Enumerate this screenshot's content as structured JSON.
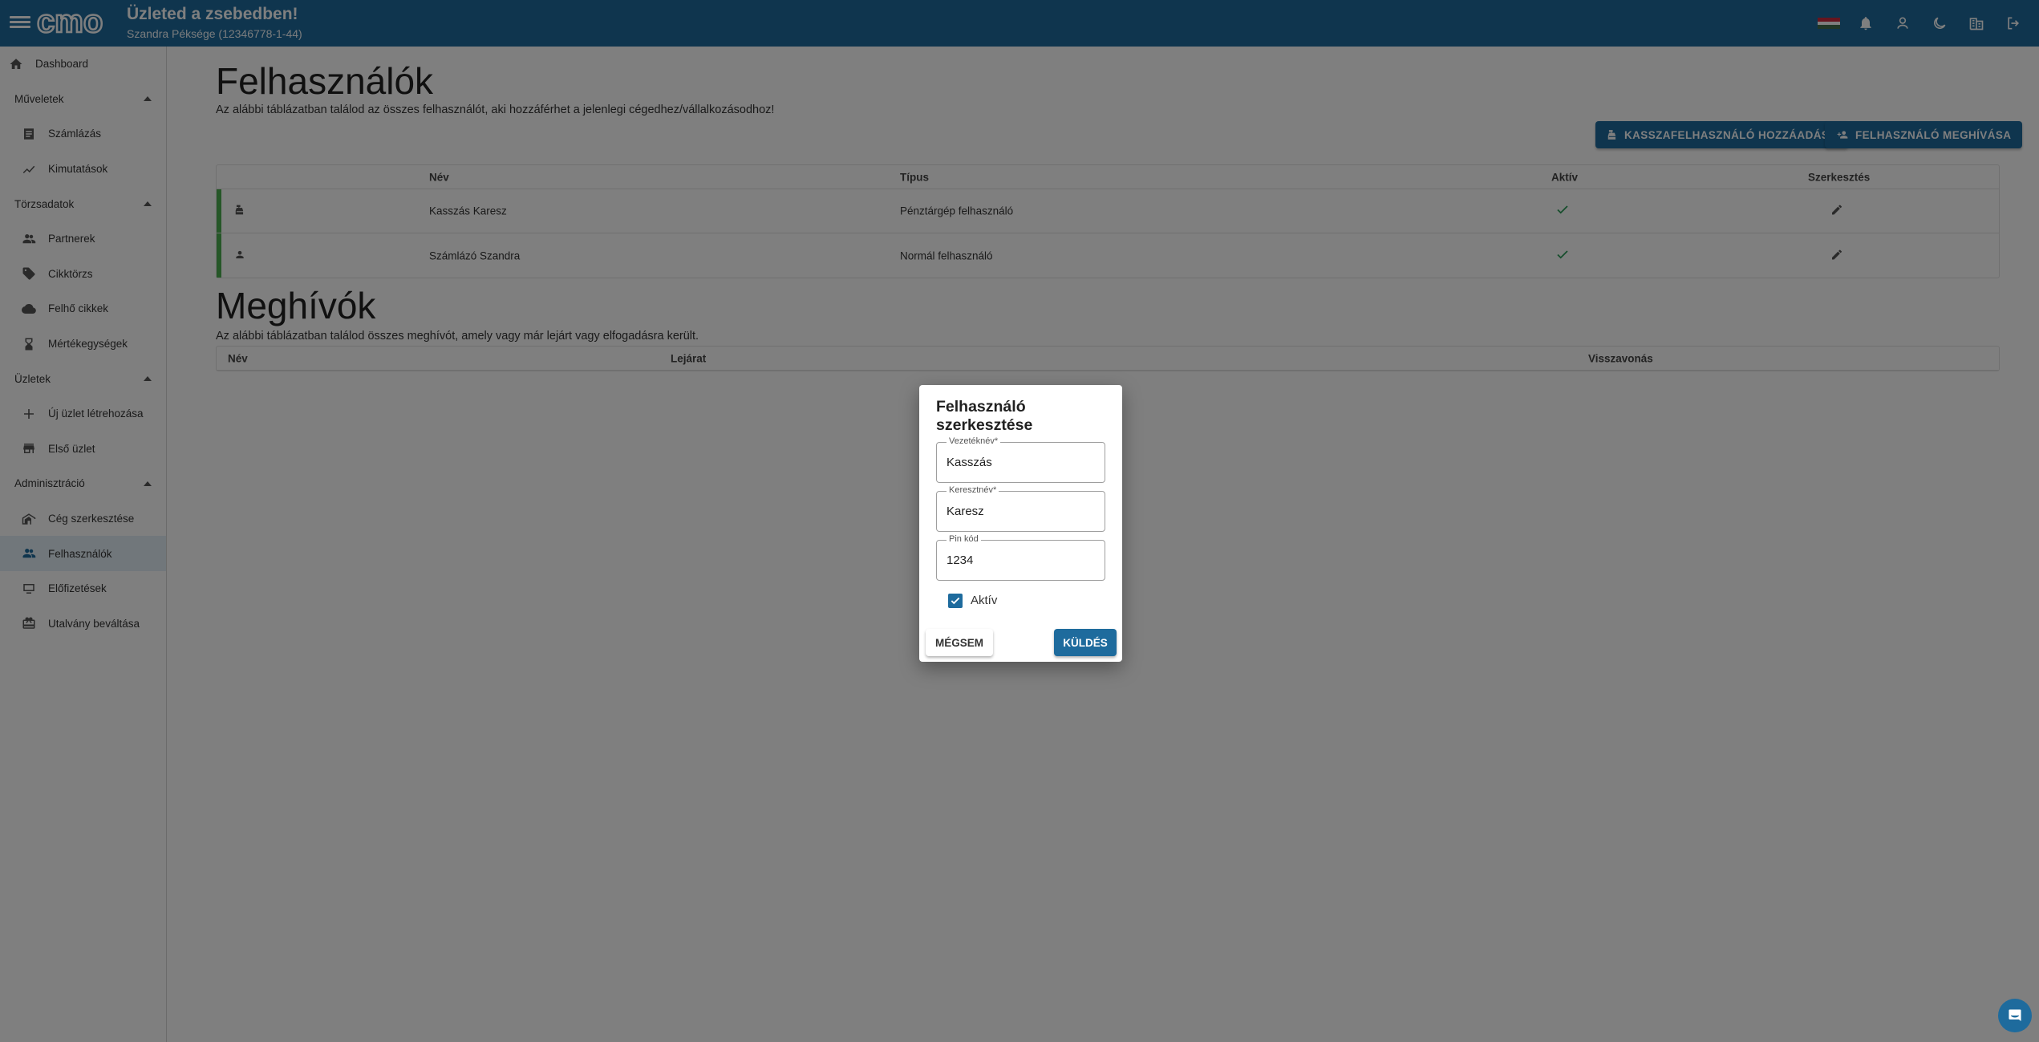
{
  "header": {
    "title": "Üzleted a zsebedben!",
    "subtitle": "Szandra Péksége (12346778-1-44)",
    "logo_text": "cmo"
  },
  "sidebar": {
    "dashboard": "Dashboard",
    "sections": {
      "muveletek": "Műveletek",
      "torzsadatok": "Törzsadatok",
      "uzletek": "Üzletek",
      "adminisztracio": "Adminisztráció"
    },
    "items": {
      "szamlazas": "Számlázás",
      "kimutatasok": "Kimutatások",
      "partnerek": "Partnerek",
      "cikktorzs": "Cikktörzs",
      "felho_cikkek": "Felhő cikkek",
      "mertekegysegek": "Mértékegységek",
      "uj_uzlet": "Új üzlet létrehozása",
      "elso_uzlet": "Első üzlet",
      "ceg_szerkesztese": "Cég szerkesztése",
      "felhasznalok": "Felhasználók",
      "elofizetesek": "Előfizetések",
      "utalvany": "Utalvány beváltása"
    }
  },
  "users_page": {
    "title": "Felhasználók",
    "description": "Az alábbi táblázatban találod az összes felhasználót, aki hozzáférhet a jelenlegi cégedhez/vállalkozásodhoz!",
    "add_cashier_button": "KASSZAFELHASZNÁLÓ HOZZÁADÁSA",
    "invite_user_button": "FELHASZNÁLÓ MEGHÍVÁSA",
    "columns": {
      "name": "Név",
      "type": "Típus",
      "active": "Aktív",
      "edit": "Szerkesztés"
    },
    "rows": [
      {
        "name": "Kasszás Karesz",
        "type": "Pénztárgép felhasználó",
        "active": true,
        "icon": "cash-register-icon"
      },
      {
        "name": "Számlázó Szandra",
        "type": "Normál felhasználó",
        "active": true,
        "icon": "person-icon"
      }
    ]
  },
  "invites_page": {
    "title": "Meghívók",
    "description": "Az alábbi táblázatban találod összes meghívót, amely vagy már lejárt vagy elfogadásra került.",
    "columns": {
      "name": "Név",
      "expiry": "Lejárat",
      "revoke": "Visszavonás"
    }
  },
  "dialog": {
    "title": "Felhasználó szerkesztése",
    "last_name_label": "Vezetéknév*",
    "last_name_value": "Kasszás",
    "first_name_label": "Keresztnév*",
    "first_name_value": "Karesz",
    "pin_label": "Pin kód",
    "pin_value": "1234",
    "active_label": "Aktív",
    "active_checked": true,
    "cancel_button": "MÉGSEM",
    "submit_button": "KÜLDÉS"
  },
  "colors": {
    "primary": "#1e6b9d",
    "active_accent": "#4caf50",
    "check": "#2e9d5a"
  }
}
